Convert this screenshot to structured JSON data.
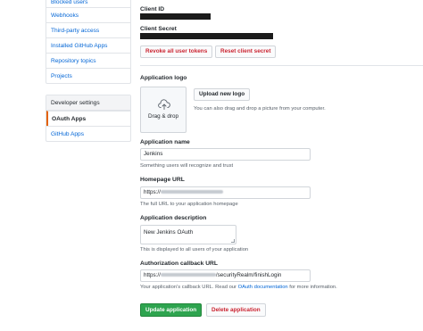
{
  "sidebar": {
    "top_items": [
      {
        "label": "Blocked users"
      },
      {
        "label": "Webhooks"
      },
      {
        "label": "Third-party access"
      },
      {
        "label": "Installed GitHub Apps"
      },
      {
        "label": "Repository topics"
      },
      {
        "label": "Projects"
      }
    ],
    "developer_header": "Developer settings",
    "developer_items": [
      {
        "label": "OAuth Apps",
        "active": true
      },
      {
        "label": "GitHub Apps",
        "active": false
      }
    ]
  },
  "credentials": {
    "client_id_label": "Client ID",
    "client_secret_label": "Client Secret",
    "revoke_button": "Revoke all user tokens",
    "reset_button": "Reset client secret"
  },
  "logo": {
    "label": "Application logo",
    "dropzone_text": "Drag & drop",
    "upload_button": "Upload new logo",
    "hint": "You can also drag and drop a picture from your computer."
  },
  "form": {
    "app_name": {
      "label": "Application name",
      "value": "Jenkins",
      "note": "Something users will recognize and trust"
    },
    "homepage": {
      "label": "Homepage URL",
      "value_prefix": "https://",
      "note": "The full URL to your application homepage"
    },
    "description": {
      "label": "Application description",
      "value": "New Jenkins OAuth",
      "note": "This is displayed to all users of your application"
    },
    "callback": {
      "label": "Authorization callback URL",
      "value_prefix": "https://",
      "value_suffix": "/securityRealm/finishLogin",
      "note_before": "Your application’s callback URL. Read our",
      "note_link": "OAuth documentation",
      "note_after": "for more information."
    }
  },
  "actions": {
    "update_button": "Update application",
    "delete_button": "Delete application"
  },
  "colors": {
    "link": "#0366d6",
    "danger": "#cb2431",
    "primary": "#2ea44f",
    "active_marker": "#e36209"
  }
}
